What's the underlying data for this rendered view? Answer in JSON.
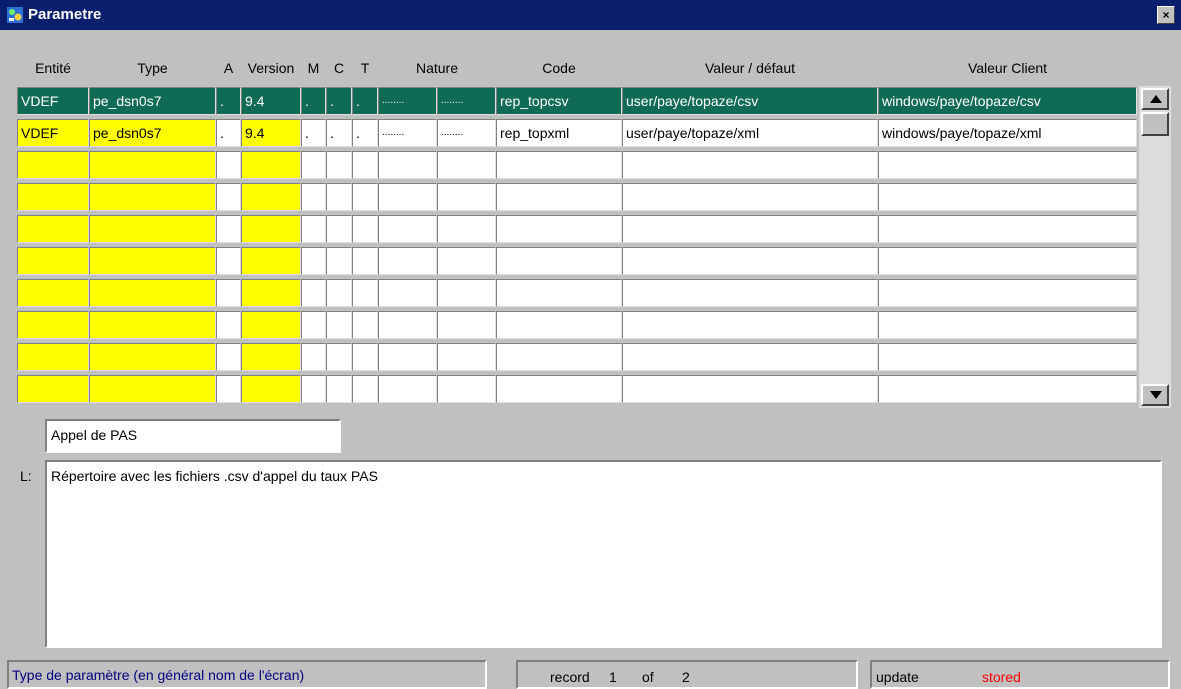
{
  "window": {
    "title": "Parametre",
    "close_glyph": "×",
    "icon": "app-icon"
  },
  "columns": [
    "Entité",
    "Type",
    "A",
    "Version",
    "M",
    "C",
    "T",
    "Nature",
    "Code",
    "Valeur / défaut",
    "Valeur Client"
  ],
  "rows": [
    {
      "entite": "VDEF",
      "type": "pe_dsn0s7",
      "a": ".",
      "version": "9.4",
      "m": ".",
      "c": ".",
      "t": ".",
      "nature1": "........",
      "nature2": "........",
      "code": "rep_topcsv",
      "defaut": "user/paye/topaze/csv",
      "client": "windows/paye/topaze/csv"
    },
    {
      "entite": "VDEF",
      "type": "pe_dsn0s7",
      "a": ".",
      "version": "9.4",
      "m": ".",
      "c": ".",
      "t": ".",
      "nature1": "........",
      "nature2": "........",
      "code": "rep_topxml",
      "defaut": "user/paye/topaze/xml",
      "client": "windows/paye/topaze/xml"
    },
    {},
    {},
    {},
    {},
    {},
    {},
    {},
    {}
  ],
  "selected_row": 0,
  "detail": {
    "short_label": "Appel de PAS",
    "long_prefix": "L:",
    "long_label": "Répertoire avec les fichiers .csv d'appel du taux PAS"
  },
  "status": {
    "hint": "Type de paramètre (en général nom de l'écran)",
    "record_word": "record",
    "record_current": "1",
    "of_word": "of",
    "record_total": "2",
    "mode": "update",
    "state": "stored"
  },
  "colors": {
    "titlebar": "#0a1e6e",
    "selected_row": "#0f6b55",
    "key_cells": "#ffff00",
    "state_text": "#ff0000",
    "hint_text": "#000080"
  }
}
